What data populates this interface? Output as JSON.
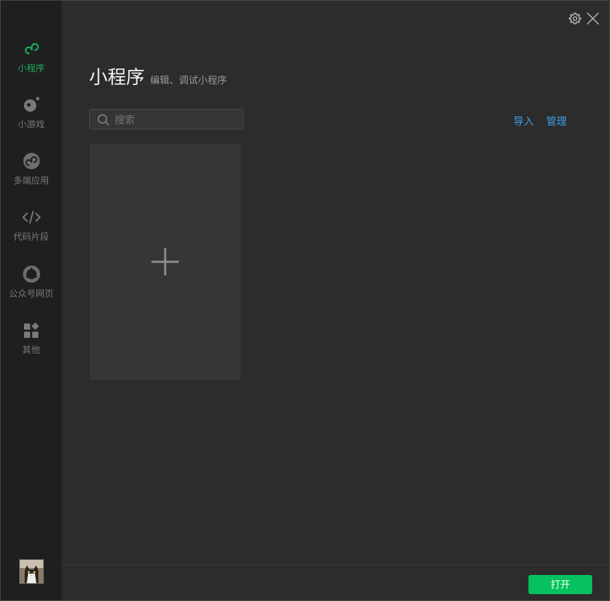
{
  "sidebar": {
    "items": [
      {
        "label": "小程序",
        "icon": "mini-program-icon",
        "active": true
      },
      {
        "label": "小游戏",
        "icon": "mini-game-icon",
        "active": false
      },
      {
        "label": "多端应用",
        "icon": "multi-platform-icon",
        "active": false
      },
      {
        "label": "代码片段",
        "icon": "code-snippet-icon",
        "active": false
      },
      {
        "label": "公众号网页",
        "icon": "official-account-icon",
        "active": false
      },
      {
        "label": "其他",
        "icon": "other-apps-icon",
        "active": false
      }
    ],
    "avatar": "user-avatar"
  },
  "header": {
    "title": "小程序",
    "subtitle": "编辑、调试小程序"
  },
  "search": {
    "placeholder": "搜索",
    "value": ""
  },
  "actions": {
    "import_label": "导入",
    "manage_label": "管理"
  },
  "footer": {
    "open_label": "打开"
  },
  "colors": {
    "accent_green": "#07c160",
    "active_nav": "#1aad5c",
    "link_blue": "#3ca0e8",
    "sidebar_bg": "#1f1f1f",
    "main_bg": "#2c2c2c"
  }
}
